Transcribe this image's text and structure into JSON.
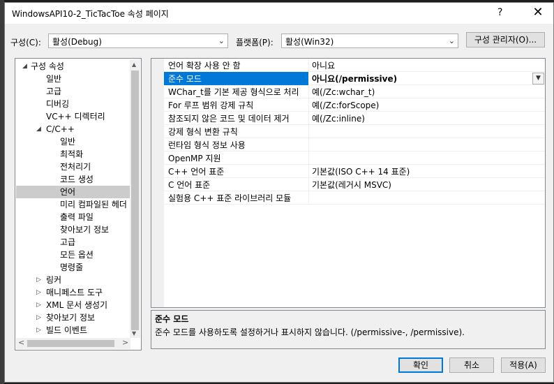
{
  "window": {
    "title": "WindowsAPI10-2_TicTacToe 속성 페이지",
    "help_glyph": "?",
    "close_glyph": "✕"
  },
  "toolbar": {
    "config_label": "구성(C):",
    "config_value": "활성(Debug)",
    "platform_label": "플랫폼(P):",
    "platform_value": "활성(Win32)",
    "config_manager_label": "구성 관리자(O)..."
  },
  "tree": {
    "items": [
      {
        "label": "구성 속성",
        "expander": "◢"
      },
      {
        "label": "일반"
      },
      {
        "label": "고급"
      },
      {
        "label": "디버깅"
      },
      {
        "label": "VC++ 디렉터리"
      },
      {
        "label": "C/C++",
        "expander": "◢"
      },
      {
        "label": "일반"
      },
      {
        "label": "최적화"
      },
      {
        "label": "전처리기"
      },
      {
        "label": "코드 생성"
      },
      {
        "label": "언어"
      },
      {
        "label": "미리 컴파일된 헤더"
      },
      {
        "label": "출력 파일"
      },
      {
        "label": "찾아보기 정보"
      },
      {
        "label": "고급"
      },
      {
        "label": "모든 옵션"
      },
      {
        "label": "명령줄"
      },
      {
        "label": "링커",
        "expander": "▷"
      },
      {
        "label": "매니페스트 도구",
        "expander": "▷"
      },
      {
        "label": "XML 문서 생성기",
        "expander": "▷"
      },
      {
        "label": "찾아보기 정보",
        "expander": "▷"
      },
      {
        "label": "빌드 이벤트",
        "expander": "▷"
      }
    ]
  },
  "properties": [
    {
      "name": "언어 확장 사용 안 함",
      "value": "아니요"
    },
    {
      "name": "준수 모드",
      "value": "아니요(/permissive)"
    },
    {
      "name": "WChar_t를 기본 제공 형식으로 처리",
      "value": "예(/Zc:wchar_t)"
    },
    {
      "name": "For 루프 범위 강제 규칙",
      "value": "예(/Zc:forScope)"
    },
    {
      "name": "참조되지 않은 코드 및 데이터 제거",
      "value": "예(/Zc:inline)"
    },
    {
      "name": "강제 형식 변환 규칙",
      "value": ""
    },
    {
      "name": "런타임 형식 정보 사용",
      "value": ""
    },
    {
      "name": "OpenMP 지원",
      "value": ""
    },
    {
      "name": "C++ 언어 표준",
      "value": "기본값(ISO C++ 14 표준)"
    },
    {
      "name": "C 언어 표준",
      "value": "기본값(레거시 MSVC)"
    },
    {
      "name": "실험용 C++ 표준 라이브러리 모듈",
      "value": ""
    }
  ],
  "description": {
    "title": "준수 모드",
    "text": "준수 모드를 사용하도록 설정하거나 표시하지 않습니다. (/permissive-, /permissive)."
  },
  "buttons": {
    "ok": "확인",
    "cancel": "취소",
    "apply": "적용(A)"
  },
  "glyphs": {
    "combo_arrow": "⌄",
    "dropdown_arrow": "▼",
    "scroll_up": "▲",
    "scroll_down": "▼",
    "scroll_left": "<",
    "scroll_right": ">"
  }
}
